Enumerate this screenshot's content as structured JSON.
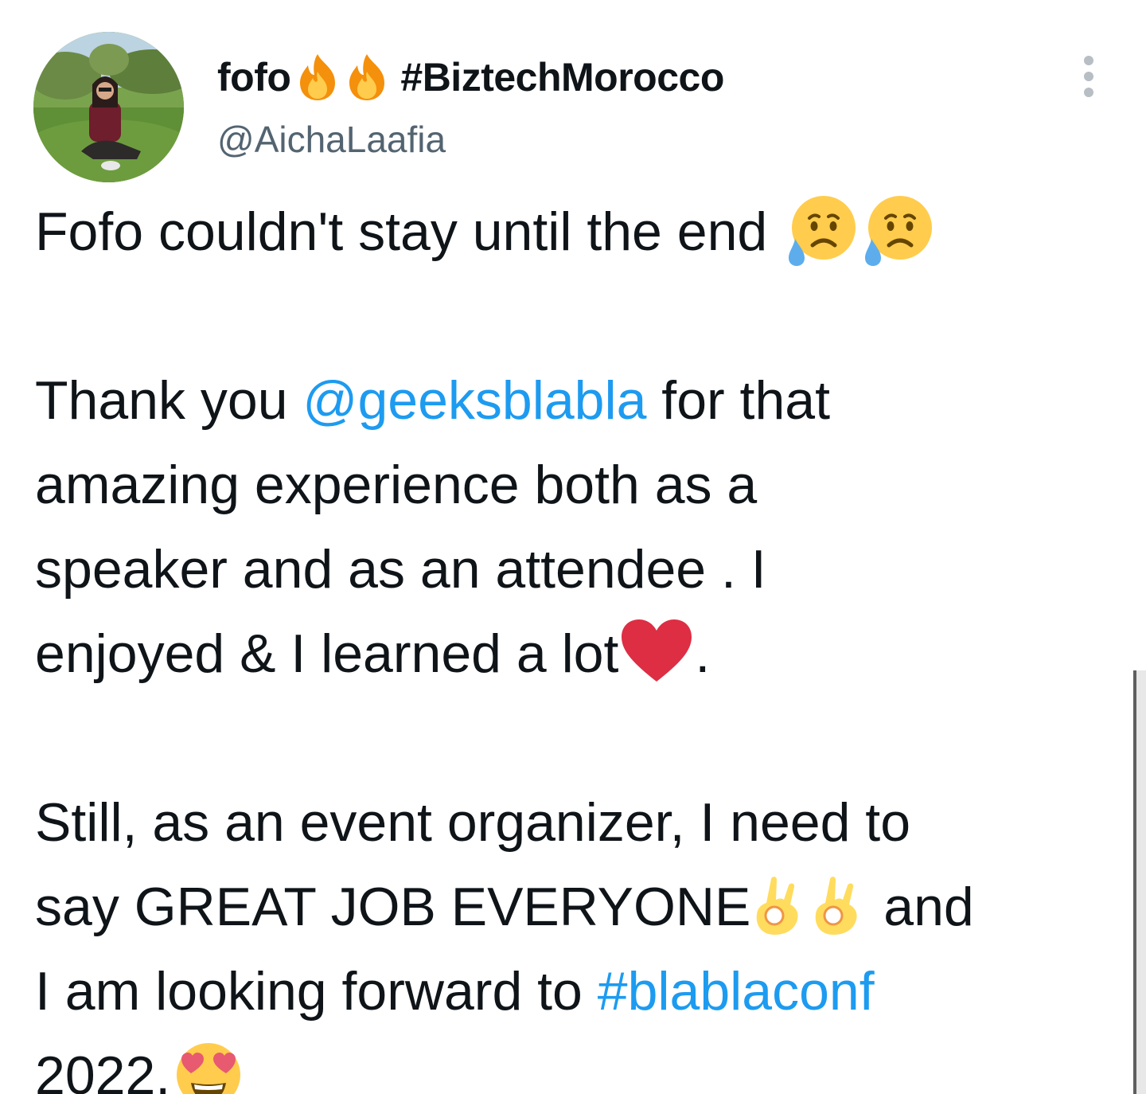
{
  "author": {
    "name": "fofo",
    "name_emojis": [
      "fire-emoji",
      "fire-emoji"
    ],
    "name_hashtag": "#BiztechMorocco",
    "handle": "@AichaLaafia"
  },
  "tweet": {
    "line1": {
      "text": "Fofo couldn't stay until the end",
      "emojis": [
        "sad-tear-emoji",
        "sad-tear-emoji"
      ]
    },
    "para2": {
      "prefix": "Thank you ",
      "mention": "@geeksblabla",
      "suffix_line1": " for that",
      "line2": "amazing experience both as a",
      "line3": "speaker and as an attendee . I",
      "line4_text": "enjoyed & I learned a lot",
      "line4_emoji": "red-heart-emoji",
      "line4_end": "."
    },
    "para3": {
      "line1": "Still, as an event organizer, I need to",
      "line2_text": "say GREAT JOB EVERYONE",
      "line2_emojis": [
        "ok-hand-emoji",
        "ok-hand-emoji"
      ],
      "line2_end": " and",
      "line3_prefix": "I am looking forward to ",
      "hashtag": "#blablaconf",
      "line4_text": "2022.",
      "line4_emoji": "heart-eyes-emoji"
    }
  },
  "colors": {
    "text": "#0f1419",
    "secondary": "#536471",
    "link": "#1d9bf0"
  }
}
